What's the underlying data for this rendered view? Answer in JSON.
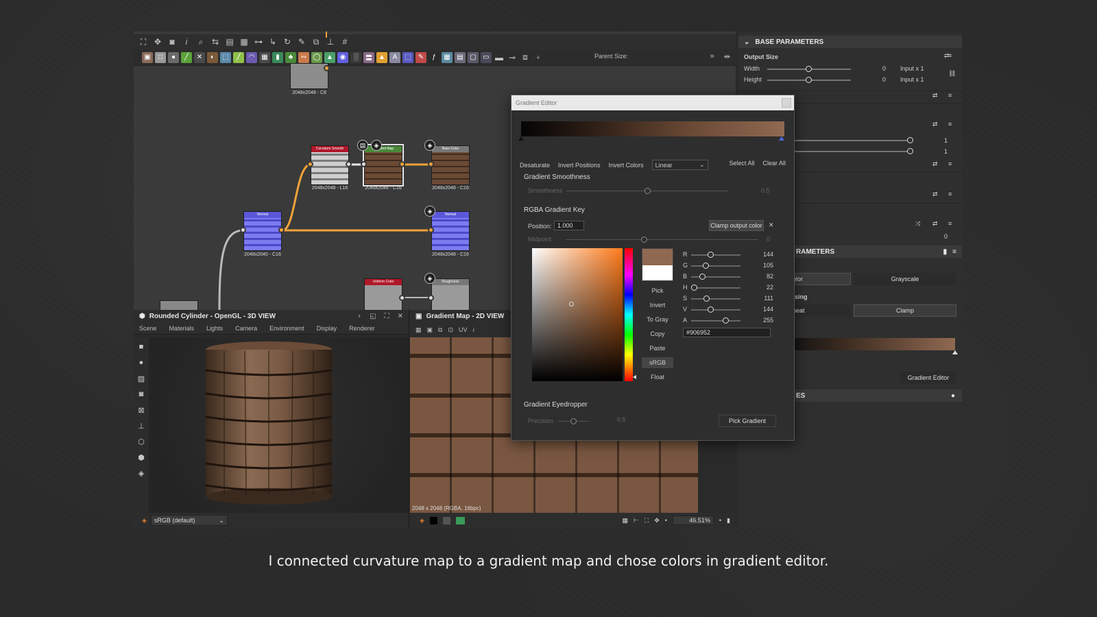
{
  "caption": "I connected curvature map to a gradient map and chose colors in gradient editor.",
  "graph": {
    "toolbar": {
      "parent_size_label": "Parent Size:"
    },
    "nodes": {
      "top_node_label": "2048x2048 - C8",
      "curvature_title": "Curvature Smooth",
      "curvature_label": "2048x2048 - L16",
      "gradient_title": "Gradient Map",
      "gradient_label": "2048x2048 - C16",
      "basecolor_title": "Base Color",
      "basecolor_label": "2048x2048 - C16",
      "normal_title": "Normal",
      "normal_label": "2048x2040 - C16",
      "normal_out_title": "Normal",
      "normal_out_label": "2048x2048 - C16",
      "uniform_title": "Uniform Color",
      "roughness_title": "Roughness"
    }
  },
  "view3d": {
    "title": "Rounded Cylinder - OpenGL - 3D VIEW",
    "menu": [
      "Scene",
      "Materials",
      "Lights",
      "Camera",
      "Environment",
      "Display",
      "Renderer"
    ],
    "colorspace": "sRGB (default)"
  },
  "view2d": {
    "title": "Gradient Map - 2D VIEW",
    "uv_label": "UV",
    "image_info": "2048 x 2048 (RGBA, 16bpc)",
    "zoom": "46.51%"
  },
  "right_panel": {
    "base_parameters": "BASE PARAMETERS",
    "output_size": "Output Size",
    "width_label": "Width",
    "width_value": "0",
    "width_mode": "Input x 1",
    "height_label": "Height",
    "height_value": "0",
    "height_mode": "Input x 1",
    "slider_val_1": "1",
    "slider_val_2": "1",
    "zero_value": "0",
    "parameters_partial": "RAMETERS",
    "color_partial": "olor",
    "grayscale": "Grayscale",
    "sing_partial": "sing",
    "repeat_partial": "peat",
    "clamp": "Clamp",
    "gradient_editor_btn": "Gradient Editor",
    "es_partial": "ES"
  },
  "gradient_editor": {
    "title": "Gradient Editor",
    "actions": [
      "Desaturate",
      "Invert Positions",
      "Invert Colors"
    ],
    "interpolation": "Linear",
    "select_all": "Select All",
    "clear_all": "Clear All",
    "smoothness_section": "Gradient Smoothness",
    "smoothness_label": "Smoothness",
    "smoothness_value": "0.5",
    "rgba_key_section": "RGBA Gradient Key",
    "position_label": "Position:",
    "position_value": "1.000",
    "clamp_output": "Clamp output color",
    "midpoint_label": "Midpoint:",
    "midpoint_value": "0",
    "side_buttons": [
      "Pick",
      "Invert",
      "To Gray",
      "Copy",
      "Paste",
      "sRGB",
      "Float"
    ],
    "channels": [
      {
        "label": "R",
        "value": "144",
        "level": 0.565
      },
      {
        "label": "G",
        "value": "105",
        "level": 0.412
      },
      {
        "label": "B",
        "value": "82",
        "level": 0.322
      },
      {
        "label": "H",
        "value": "22",
        "level": 0.086
      },
      {
        "label": "S",
        "value": "111",
        "level": 0.435
      },
      {
        "label": "V",
        "value": "144",
        "level": 0.565
      },
      {
        "label": "A",
        "value": "255",
        "level": 1.0
      }
    ],
    "hex": "#906952",
    "eyedropper_section": "Gradient Eyedropper",
    "precision_label": "Precision",
    "precision_value": "0.5",
    "pick_gradient": "Pick Gradient",
    "colors": {
      "current": "#906952",
      "previous": "#ffffff"
    }
  }
}
